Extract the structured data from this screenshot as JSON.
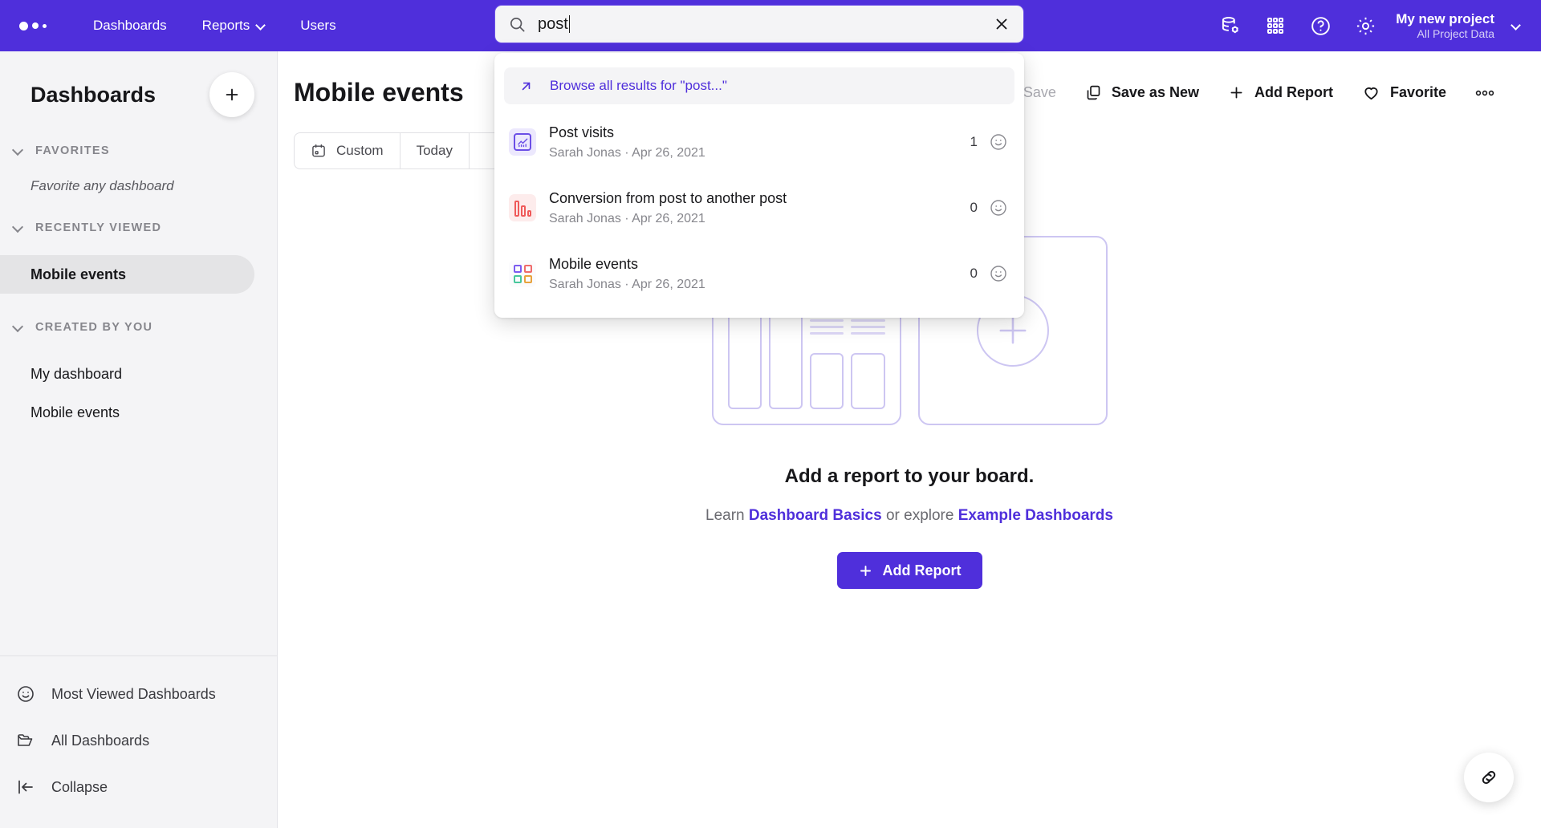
{
  "header": {
    "logo": "three-dots-logo",
    "nav": [
      {
        "label": "Dashboards",
        "has_caret": false
      },
      {
        "label": "Reports",
        "has_caret": true
      },
      {
        "label": "Users",
        "has_caret": false
      }
    ],
    "icons": [
      "database-settings-icon",
      "grid-apps-icon",
      "help-circle-icon",
      "gear-icon"
    ],
    "project": {
      "name": "My new project",
      "scope": "All Project Data"
    },
    "accent": "#4f2fdb"
  },
  "search": {
    "query": "post",
    "placeholder": "Search",
    "browse_all_label": "Browse all results for \"post...\"",
    "results": [
      {
        "title": "Post visits",
        "meta": "Sarah Jonas · Apr 26, 2021",
        "count": "1",
        "icon": "line-chart-icon"
      },
      {
        "title": "Conversion from post to another post",
        "meta": "Sarah Jonas · Apr 26, 2021",
        "count": "0",
        "icon": "bar-chart-icon"
      },
      {
        "title": "Mobile events",
        "meta": "Sarah Jonas · Apr 26, 2021",
        "count": "0",
        "icon": "dashboard-grid-icon"
      }
    ]
  },
  "sidebar": {
    "title": "Dashboards",
    "add_tooltip": "Add dashboard",
    "sections": [
      {
        "label": "FAVORITES",
        "empty_text": "Favorite any dashboard"
      },
      {
        "label": "RECENTLY VIEWED"
      },
      {
        "label": "CREATED BY YOU"
      }
    ],
    "recently_viewed": [
      {
        "label": "Mobile events",
        "active": true
      }
    ],
    "created_by_you": [
      {
        "label": "My dashboard"
      },
      {
        "label": "Mobile events"
      }
    ],
    "footer": [
      {
        "label": "Most Viewed Dashboards",
        "icon": "smiley-icon"
      },
      {
        "label": "All Dashboards",
        "icon": "folder-icon"
      },
      {
        "label": "Collapse",
        "icon": "collapse-left-icon"
      }
    ]
  },
  "main": {
    "page_title": "Mobile events",
    "toolbar": {
      "save_label": "Save",
      "save_as_new_label": "Save as New",
      "add_report_label": "Add Report",
      "favorite_label": "Favorite",
      "more_label": "•••"
    },
    "date_tabs": [
      {
        "label": "Custom",
        "icon": "calendar-icon"
      },
      {
        "label": "Today",
        "icon": ""
      }
    ],
    "empty_state": {
      "title": "Add a report to your board.",
      "sub_prefix": "Learn ",
      "link1": "Dashboard Basics",
      "sub_middle": " or explore ",
      "link2": "Example Dashboards",
      "button_label": "Add Report"
    },
    "fab_icon": "link-chain-icon"
  }
}
